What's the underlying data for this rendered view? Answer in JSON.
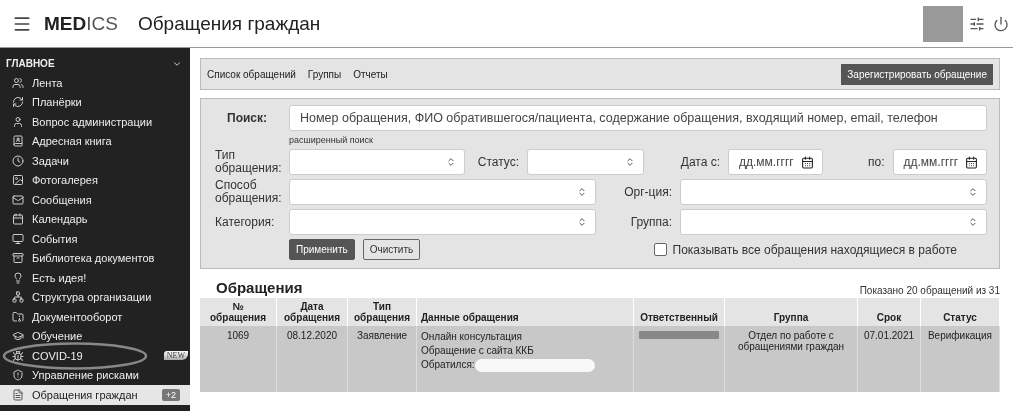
{
  "header": {
    "brand_bold": "MED",
    "brand_light": "ICS",
    "title": "Обращения граждан"
  },
  "sidebar": {
    "section": "ГЛАВНОЕ",
    "expanded": true,
    "items": [
      {
        "label": "Лента",
        "selected": false
      },
      {
        "label": "Планёрки",
        "selected": false
      },
      {
        "label": "Вопрос администрации",
        "selected": false
      },
      {
        "label": "Адресная книга",
        "selected": false
      },
      {
        "label": "Задачи",
        "selected": false
      },
      {
        "label": "Фотогалерея",
        "selected": false
      },
      {
        "label": "Сообщения",
        "selected": false
      },
      {
        "label": "Календарь",
        "selected": false
      },
      {
        "label": "События",
        "selected": false
      },
      {
        "label": "Библиотека документов",
        "selected": false
      },
      {
        "label": "Есть идея!",
        "selected": false
      },
      {
        "label": "Структура организации",
        "selected": false
      },
      {
        "label": "Документооборот",
        "selected": false
      },
      {
        "label": "Обучение",
        "selected": false
      },
      {
        "label": "COVID-19",
        "selected": false,
        "badge": {
          "text": "NEW",
          "kind": "ribbon"
        }
      },
      {
        "label": "Управление рисками",
        "selected": false
      },
      {
        "label": "Обращения граждан",
        "selected": true,
        "badge": {
          "text": "+2",
          "kind": "count"
        }
      }
    ]
  },
  "toolbar": {
    "tabs": [
      "Список обращений",
      "Группы",
      "Отчеты"
    ],
    "action": "Зарегистрировать обращение"
  },
  "filters": {
    "search_label": "Поиск:",
    "search_placeholder": "Номер обращения, ФИО обратившегося/пациента, содержание обращения, входящий номер, email, телефон",
    "advanced_link": "расширенный поиск",
    "type_label": "Тип обращения:",
    "status_label": "Статус:",
    "date_from_label": "Дата с:",
    "date_from_placeholder": "дд.мм.гггг",
    "date_to_label": "по:",
    "date_to_placeholder": "дд.мм.гггг",
    "method_label": "Способ обращения:",
    "org_label": "Орг-ция:",
    "category_label": "Категория:",
    "group_label": "Группа:",
    "apply": "Применить",
    "clear": "Очистить",
    "show_all": {
      "label": "Показывать все обращения находящиеся в работе",
      "checked": false
    }
  },
  "table": {
    "title": "Обращения",
    "count": "Показано 20 обращений из 31",
    "columns": [
      "№ обращения",
      "Дата обращения",
      "Тип обращения",
      "Данные обращения",
      "Ответственный",
      "Группа",
      "Срок",
      "Статус"
    ],
    "rows": [
      {
        "selected": true,
        "number": "1069",
        "date": "08.12.2020",
        "type": "Заявление",
        "details": [
          "Онлайн консультация",
          "Обращение с сайта ККБ",
          "Обратился:"
        ],
        "group": "Отдел по работе с обращениями граждан",
        "due": "07.01.2021",
        "status": "Верификация"
      }
    ]
  }
}
